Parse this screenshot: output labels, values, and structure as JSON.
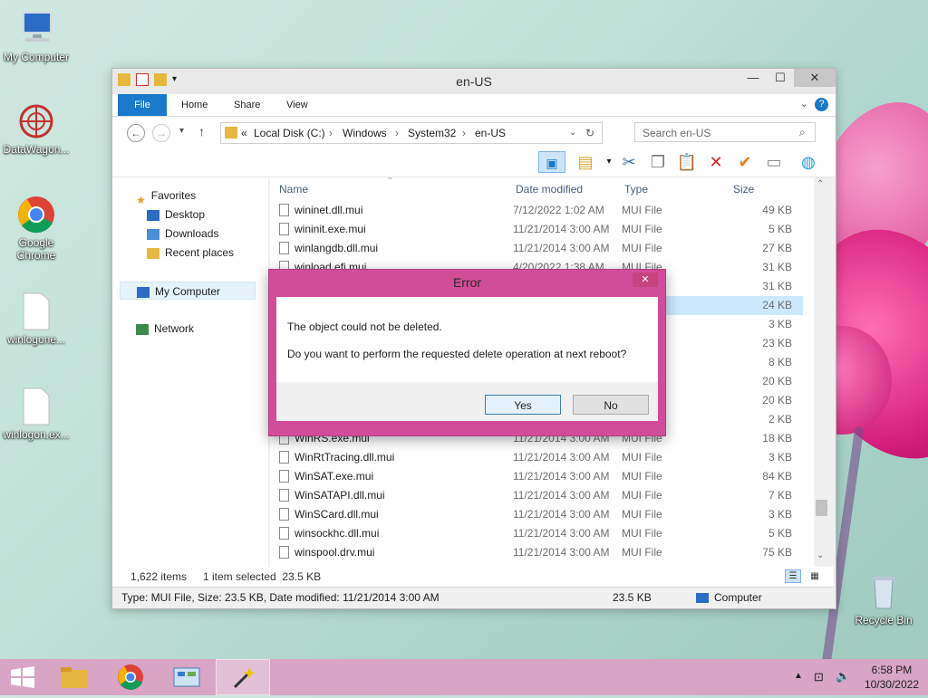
{
  "desktop": {
    "icons": [
      {
        "label": "My Computer"
      },
      {
        "label": "DataWagon..."
      },
      {
        "label": "Google Chrome"
      },
      {
        "label": "winlogone..."
      },
      {
        "label": "winlogon.ex..."
      },
      {
        "label": "Recycle Bin"
      }
    ]
  },
  "window": {
    "title": "en-US",
    "ribbon_tabs": [
      "File",
      "Home",
      "Share",
      "View"
    ],
    "breadcrumb": [
      "«",
      "Local Disk (C:)",
      "Windows",
      "System32",
      "en-US"
    ],
    "search_placeholder": "Search en-US",
    "nav": {
      "favorites": "Favorites",
      "desktop": "Desktop",
      "downloads": "Downloads",
      "recent": "Recent places",
      "mycomputer": "My Computer",
      "network": "Network"
    },
    "columns": {
      "name": "Name",
      "date": "Date modified",
      "type": "Type",
      "size": "Size"
    },
    "rows": [
      {
        "name": "wininet.dll.mui",
        "date": "7/12/2022 1:02 AM",
        "type": "MUI File",
        "size": "49 KB"
      },
      {
        "name": "wininit.exe.mui",
        "date": "11/21/2014 3:00 AM",
        "type": "MUI File",
        "size": "5 KB"
      },
      {
        "name": "winlangdb.dll.mui",
        "date": "11/21/2014 3:00 AM",
        "type": "MUI File",
        "size": "27 KB"
      },
      {
        "name": "winload.efi.mui",
        "date": "4/20/2022 1:38 AM",
        "type": "MUI File",
        "size": "31 KB"
      },
      {
        "name": "",
        "date": "",
        "type": "",
        "size": "31 KB"
      },
      {
        "name": "",
        "date": "",
        "type": "",
        "size": "24 KB"
      },
      {
        "name": "",
        "date": "",
        "type": "",
        "size": "3 KB"
      },
      {
        "name": "",
        "date": "",
        "type": "",
        "size": "23 KB"
      },
      {
        "name": "",
        "date": "",
        "type": "",
        "size": "8 KB"
      },
      {
        "name": "",
        "date": "",
        "type": "",
        "size": "20 KB"
      },
      {
        "name": "",
        "date": "",
        "type": "",
        "size": "20 KB"
      },
      {
        "name": "",
        "date": "",
        "type": "",
        "size": "2 KB"
      },
      {
        "name": "WinRS.exe.mui",
        "date": "11/21/2014 3:00 AM",
        "type": "MUI File",
        "size": "18 KB"
      },
      {
        "name": "WinRtTracing.dll.mui",
        "date": "11/21/2014 3:00 AM",
        "type": "MUI File",
        "size": "3 KB"
      },
      {
        "name": "WinSAT.exe.mui",
        "date": "11/21/2014 3:00 AM",
        "type": "MUI File",
        "size": "84 KB"
      },
      {
        "name": "WinSATAPI.dll.mui",
        "date": "11/21/2014 3:00 AM",
        "type": "MUI File",
        "size": "7 KB"
      },
      {
        "name": "WinSCard.dll.mui",
        "date": "11/21/2014 3:00 AM",
        "type": "MUI File",
        "size": "3 KB"
      },
      {
        "name": "winsockhc.dll.mui",
        "date": "11/21/2014 3:00 AM",
        "type": "MUI File",
        "size": "5 KB"
      },
      {
        "name": "winspool.drv.mui",
        "date": "11/21/2014 3:00 AM",
        "type": "MUI File",
        "size": "75 KB"
      }
    ],
    "status": {
      "items": "1,622 items",
      "selected": "1 item selected  23.5 KB"
    },
    "infobar": {
      "details": "Type: MUI File, Size: 23.5 KB, Date modified: 11/21/2014 3:00 AM",
      "size": "23.5 KB",
      "location": "Computer"
    }
  },
  "dialog": {
    "title": "Error",
    "message1": "The object could not be deleted.",
    "message2": "Do you want to perform the requested delete operation at next reboot?",
    "yes": "Yes",
    "no": "No"
  },
  "taskbar": {
    "time": "6:58 PM",
    "date": "10/30/2022"
  },
  "colors": {
    "accent": "#1979ca",
    "dialog_frame": "#d24d98",
    "taskbar": "#d8a5c5"
  }
}
